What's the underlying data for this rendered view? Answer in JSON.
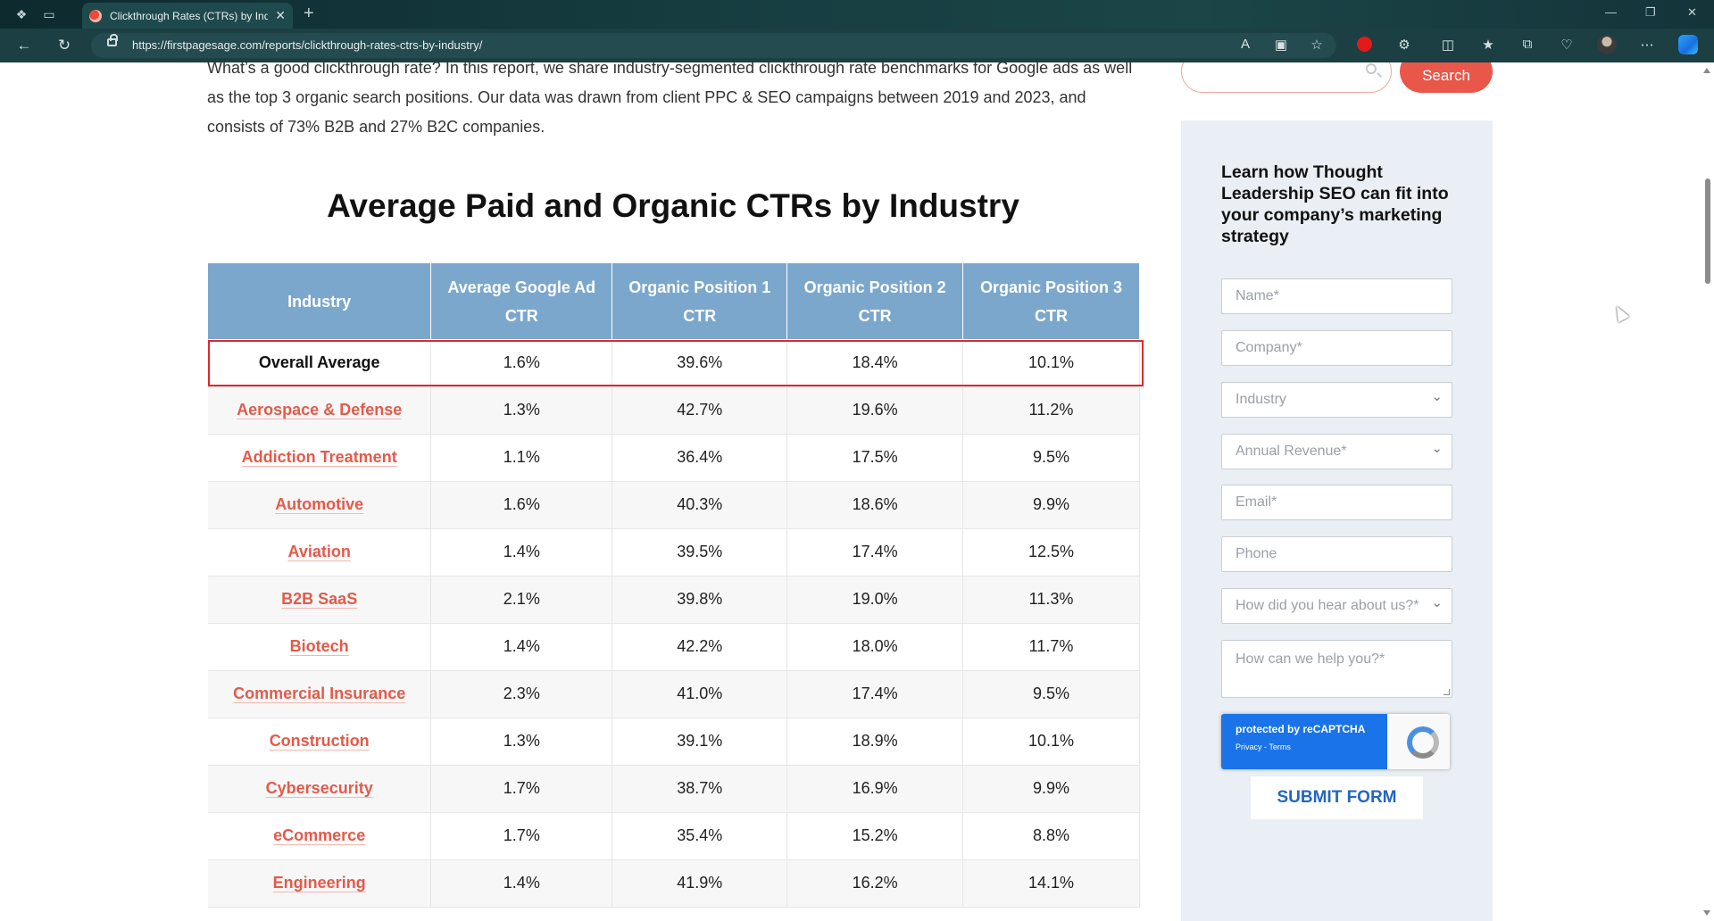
{
  "browser": {
    "tab_title": "Clickthrough Rates (CTRs) by Ind",
    "url": "https://firstpagesage.com/reports/clickthrough-rates-ctrs-by-industry/"
  },
  "intro": {
    "text": "What’s a good clickthrough rate? In this report, we share industry-segmented clickthrough rate benchmarks for Google ads as well as the top 3 organic search positions. Our data was drawn from client PPC & SEO campaigns between 2019 and 2023, and consists of 73% B2B and 27% B2C companies."
  },
  "section_title": "Average Paid and Organic CTRs by Industry",
  "table": {
    "headers": [
      "Industry",
      "Average Google Ad CTR",
      "Organic Position 1 CTR",
      "Organic Position 2 CTR",
      "Organic Position 3 CTR"
    ],
    "rows": [
      {
        "industry": "Overall Average",
        "ad": "1.6%",
        "p1": "39.6%",
        "p2": "18.4%",
        "p3": "10.1%"
      },
      {
        "industry": "Aerospace & Defense",
        "ad": "1.3%",
        "p1": "42.7%",
        "p2": "19.6%",
        "p3": "11.2%"
      },
      {
        "industry": "Addiction Treatment",
        "ad": "1.1%",
        "p1": "36.4%",
        "p2": "17.5%",
        "p3": "9.5%"
      },
      {
        "industry": "Automotive",
        "ad": "1.6%",
        "p1": "40.3%",
        "p2": "18.6%",
        "p3": "9.9%"
      },
      {
        "industry": "Aviation",
        "ad": "1.4%",
        "p1": "39.5%",
        "p2": "17.4%",
        "p3": "12.5%"
      },
      {
        "industry": "B2B SaaS",
        "ad": "2.1%",
        "p1": "39.8%",
        "p2": "19.0%",
        "p3": "11.3%"
      },
      {
        "industry": "Biotech",
        "ad": "1.4%",
        "p1": "42.2%",
        "p2": "18.0%",
        "p3": "11.7%"
      },
      {
        "industry": "Commercial Insurance",
        "ad": "2.3%",
        "p1": "41.0%",
        "p2": "17.4%",
        "p3": "9.5%"
      },
      {
        "industry": "Construction",
        "ad": "1.3%",
        "p1": "39.1%",
        "p2": "18.9%",
        "p3": "10.1%"
      },
      {
        "industry": "Cybersecurity",
        "ad": "1.7%",
        "p1": "38.7%",
        "p2": "16.9%",
        "p3": "9.9%"
      },
      {
        "industry": "eCommerce",
        "ad": "1.7%",
        "p1": "35.4%",
        "p2": "15.2%",
        "p3": "8.8%"
      },
      {
        "industry": "Engineering",
        "ad": "1.4%",
        "p1": "41.9%",
        "p2": "16.2%",
        "p3": "14.1%"
      }
    ]
  },
  "search": {
    "button_label": "Search"
  },
  "sidebar": {
    "title": "Learn how Thought Leadership SEO can fit into your company’s marketing strategy",
    "fields": {
      "name": "Name*",
      "company": "Company*",
      "industry": "Industry",
      "revenue": "Annual Revenue*",
      "email": "Email*",
      "phone": "Phone",
      "hear": "How did you hear about us?*",
      "help": "How can we help you?*"
    },
    "recaptcha_main": "protected by reCAPTCHA",
    "recaptcha_links": "Privacy - Terms",
    "submit_label": "SUBMIT FORM"
  },
  "colors": {
    "header_bg": "#7ba7cc",
    "industry_link": "#e45a4a",
    "highlight_border": "#e0282a",
    "search_button": "#e8574a",
    "sidebar_bg": "#e9eff4",
    "submit_text": "#2266c0"
  }
}
